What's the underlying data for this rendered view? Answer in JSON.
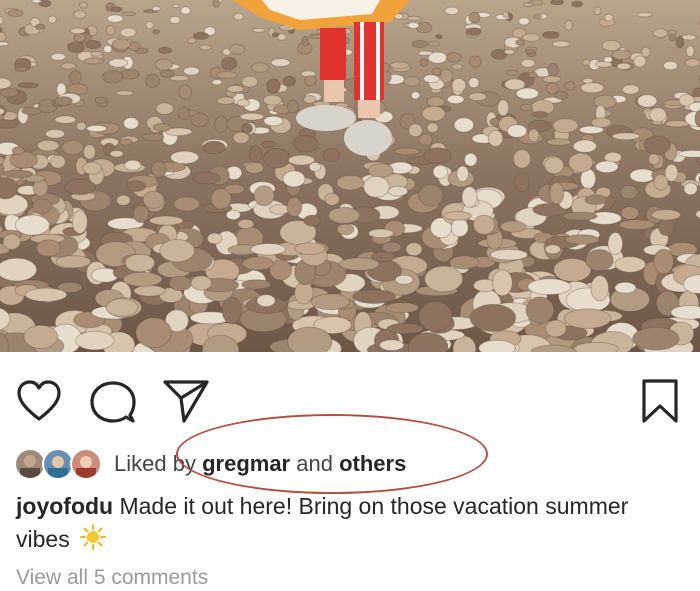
{
  "post": {
    "photo_icon": "beach-pebbles-photo",
    "actions": {
      "like_icon": "heart-icon",
      "comment_icon": "comment-bubble-icon",
      "share_icon": "paper-plane-icon",
      "save_icon": "bookmark-icon"
    },
    "likes": {
      "prefix": "Liked by",
      "user": "gregmar",
      "conjunction": "and",
      "others": "others"
    },
    "caption": {
      "username": "joyofodu",
      "text": "Made it out here! Bring on those vacation summer vibes",
      "emoji_icon": "sun-emoji-icon"
    },
    "comments_link": "View all 5 comments",
    "annotation_color": "#b2503f"
  }
}
